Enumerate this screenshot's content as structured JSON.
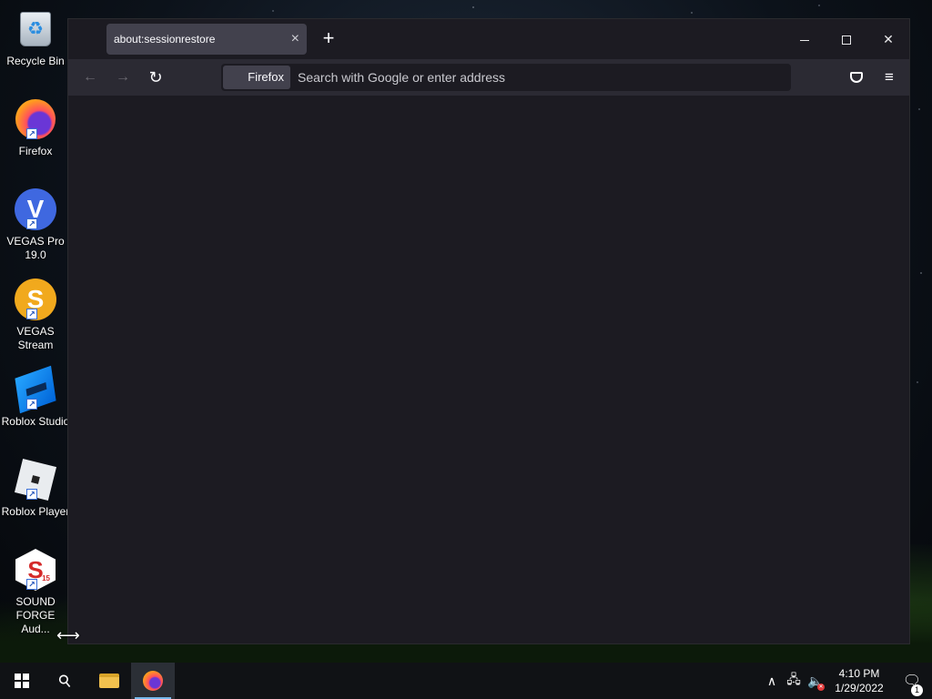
{
  "desktop": {
    "icons": [
      {
        "label": "Recycle Bin",
        "icon": "recycle-bin-icon"
      },
      {
        "label": "Firefox",
        "icon": "firefox-icon"
      },
      {
        "label": "VEGAS Pro 19.0",
        "icon": "vegas-pro-icon",
        "glyph": "V"
      },
      {
        "label": "VEGAS Stream",
        "icon": "vegas-stream-icon",
        "glyph": "S"
      },
      {
        "label": "Roblox Studio",
        "icon": "roblox-studio-icon"
      },
      {
        "label": "Roblox Player",
        "icon": "roblox-player-icon"
      },
      {
        "label": "SOUND FORGE Aud...",
        "icon": "sound-forge-icon",
        "glyph": "S",
        "badge": "15"
      }
    ]
  },
  "browser": {
    "tab": {
      "title": "about:sessionrestore",
      "close": "×"
    },
    "new_tab": "+",
    "window_controls": {
      "close": "✕"
    },
    "nav": {
      "back": "←",
      "forward": "→",
      "reload": "↻"
    },
    "urlbar": {
      "identity_label": "Firefox",
      "placeholder": "Search with Google or enter address",
      "value": ""
    },
    "menu": "≡"
  },
  "taskbar": {
    "search_glyph": "⚲",
    "tray": {
      "chevron": "∧",
      "network": "🖧",
      "volume": "🔈"
    },
    "clock": {
      "time": "4:10 PM",
      "date": "1/29/2022"
    },
    "notifications": {
      "count": "1"
    }
  },
  "colors": {
    "window_bg": "#1c1b22",
    "toolbar_bg": "#2b2a33",
    "tab_bg": "#42414d",
    "taskbar_bg": "#101215",
    "taskbar_active_indicator": "#76b9ed"
  }
}
